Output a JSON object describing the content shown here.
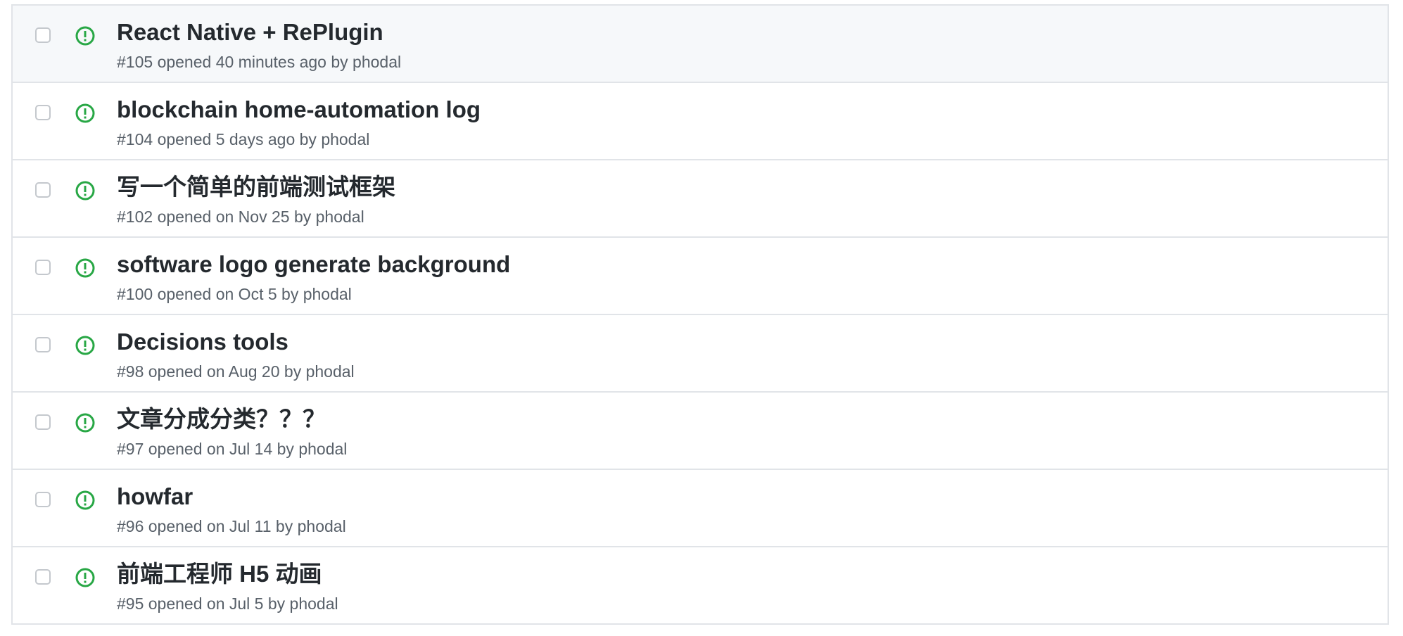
{
  "issues": [
    {
      "title": "React Native + RePlugin",
      "number": "#105",
      "opened_text": "opened 40 minutes ago by",
      "author": "phodal"
    },
    {
      "title": "blockchain home-automation log",
      "number": "#104",
      "opened_text": "opened 5 days ago by",
      "author": "phodal"
    },
    {
      "title": "写一个简单的前端测试框架",
      "number": "#102",
      "opened_text": "opened on Nov 25 by",
      "author": "phodal"
    },
    {
      "title": "software logo generate background",
      "number": "#100",
      "opened_text": "opened on Oct 5 by",
      "author": "phodal"
    },
    {
      "title": "Decisions tools",
      "number": "#98",
      "opened_text": "opened on Aug 20 by",
      "author": "phodal"
    },
    {
      "title": "文章分成分类？？？",
      "number": "#97",
      "opened_text": "opened on Jul 14 by",
      "author": "phodal"
    },
    {
      "title": "howfar",
      "number": "#96",
      "opened_text": "opened on Jul 11 by",
      "author": "phodal"
    },
    {
      "title": "前端工程师 H5 动画",
      "number": "#95",
      "opened_text": "opened on Jul 5 by",
      "author": "phodal"
    }
  ],
  "colors": {
    "open_icon": "#28a745",
    "hover_row": "#f6f8fa",
    "border": "#e1e4e8"
  },
  "icons": {
    "status": "issue-opened-icon"
  }
}
